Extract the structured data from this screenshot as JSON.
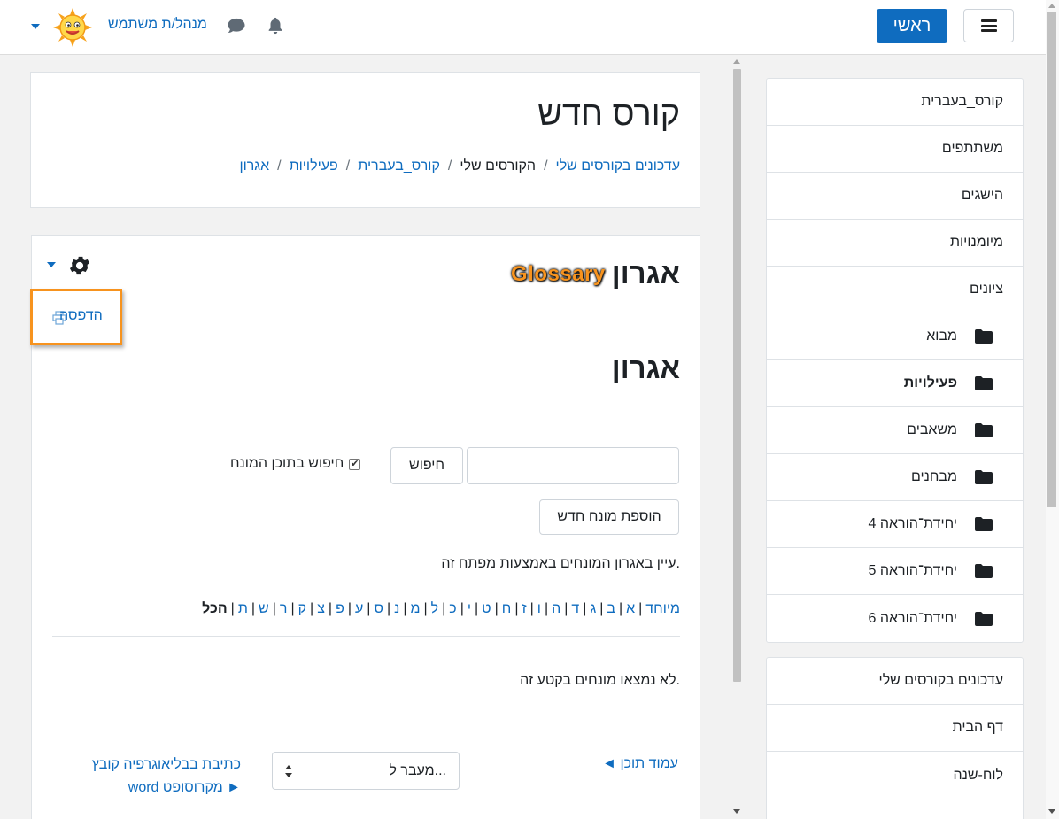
{
  "navbar": {
    "home_label": "ראשי",
    "username": "מנהל/ת משתמש",
    "icons": [
      "menu-icon",
      "bell-icon",
      "chat-icon",
      "avatar",
      "chevron-down-icon"
    ]
  },
  "header": {
    "title": "קורס חדש",
    "breadcrumb": [
      "עדכונים בקורסים שלי",
      "הקורסים שלי",
      "קורס_בעברית",
      "פעילויות",
      "אגרון"
    ],
    "separator": "/"
  },
  "main": {
    "title": "אגרון",
    "tag": "Glossary",
    "print_label": "הדפסה",
    "subtitle": "אגרון",
    "search_input_value": "",
    "search_button": "חיפוש",
    "search_full_label": "חיפוש בתוכן המונח",
    "search_full_checked": true,
    "add_entry_button": "הוספת מונח חדש",
    "browse_text": "עיין באגרון המונחים באמצעות מפתח זה.",
    "alphabet": [
      "מיוחד",
      "א",
      "ב",
      "ג",
      "ד",
      "ה",
      "ו",
      "ז",
      "ח",
      "ט",
      "י",
      "כ",
      "ל",
      "מ",
      "נ",
      "ס",
      "ע",
      "פ",
      "צ",
      "ק",
      "ר",
      "ש",
      "ת"
    ],
    "all_label": "הכל",
    "no_entries": "לא נמצאו מונחים בקטע זה.",
    "prev_activity": "◄ עמוד תוכן",
    "jump_to": "מעבר ל...",
    "next_activity_line1": "כתיבת בבליאוגרפיה קובץ",
    "next_activity_line2": "word מקרוסופט ►"
  },
  "sidebar": {
    "items": [
      {
        "label": "קורס_בעברית",
        "folder": false,
        "bold": false
      },
      {
        "label": "משתתפים",
        "folder": false,
        "bold": false
      },
      {
        "label": "הישגים",
        "folder": false,
        "bold": false
      },
      {
        "label": "מיומנויות",
        "folder": false,
        "bold": false
      },
      {
        "label": "ציונים",
        "folder": false,
        "bold": false
      },
      {
        "label": "מבוא",
        "folder": true,
        "bold": false
      },
      {
        "label": "פעילויות",
        "folder": true,
        "bold": true
      },
      {
        "label": "משאבים",
        "folder": true,
        "bold": false
      },
      {
        "label": "מבחנים",
        "folder": true,
        "bold": false
      },
      {
        "label": "יחידת־הוראה 4",
        "folder": true,
        "bold": false
      },
      {
        "label": "יחידת־הוראה 5",
        "folder": true,
        "bold": false
      },
      {
        "label": "יחידת־הוראה 6",
        "folder": true,
        "bold": false
      }
    ],
    "items2": [
      {
        "label": "עדכונים בקורסים שלי"
      },
      {
        "label": "דף הבית"
      },
      {
        "label": "לוח-שנה"
      }
    ]
  },
  "colors": {
    "link": "#0f6cbf",
    "accent_orange": "#f7931e",
    "brand": "#0f6cbf"
  }
}
